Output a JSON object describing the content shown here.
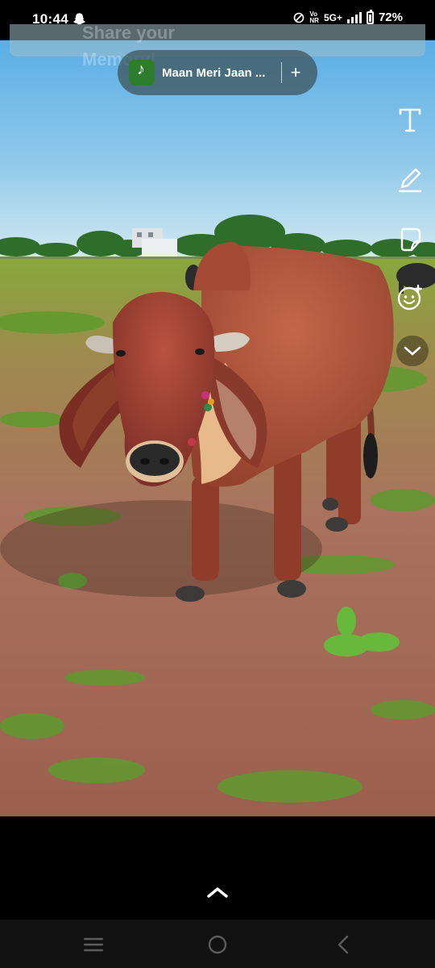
{
  "status": {
    "time": "10:44",
    "volte_top": "Vo",
    "volte_bottom": "NR",
    "network": "5G+",
    "battery": "72%",
    "battery_level": 0.72
  },
  "caption": {
    "text": "Share your Memory!"
  },
  "music": {
    "title": "Maan Meri Jaan ...",
    "add_label": "+"
  },
  "tools": {
    "text_label": "T",
    "icons": [
      "text-tool-icon",
      "pen-tool-icon",
      "sticker-icon",
      "emoji-sticker-icon",
      "chevron-down-icon"
    ]
  },
  "bottom": {
    "swipe_icon": "chevron-up-icon"
  },
  "nav": {
    "icons": [
      "recents-icon",
      "home-icon",
      "back-icon"
    ]
  },
  "colors": {
    "sky_top": "#5aaee6",
    "sky_bottom": "#cfe6ef",
    "cow": "#b3553c",
    "soil": "#a56a55",
    "grass": "#5f9a2f"
  }
}
